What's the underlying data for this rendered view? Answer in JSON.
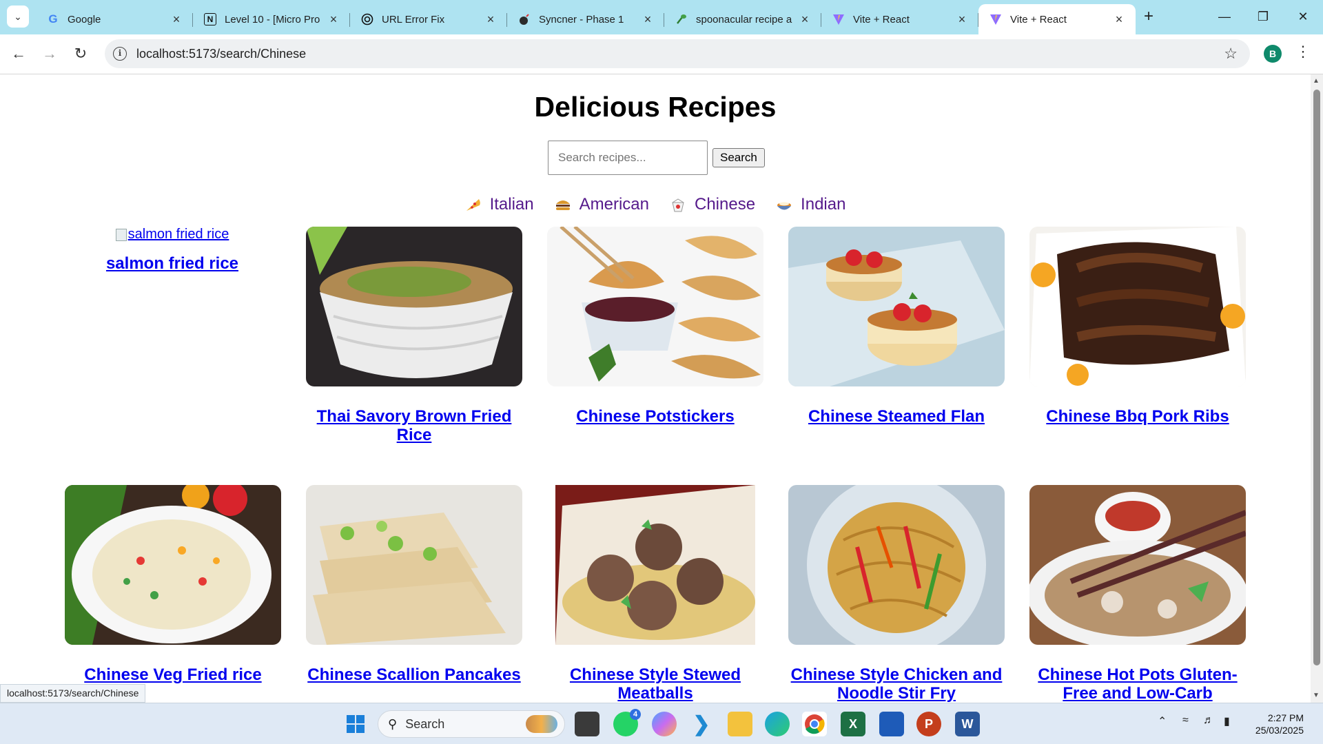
{
  "browser": {
    "tabs": [
      {
        "title": "Google",
        "icon": "google-icon"
      },
      {
        "title": "Level 10 - [Micro Pro",
        "icon": "notion-icon"
      },
      {
        "title": "URL Error Fix",
        "icon": "openai-icon"
      },
      {
        "title": "Syncner - Phase 1",
        "icon": "bomb-icon"
      },
      {
        "title": "spoonacular recipe a",
        "icon": "spoonacular-icon"
      },
      {
        "title": "Vite + React",
        "icon": "vite-icon"
      },
      {
        "title": "Vite + React",
        "icon": "vite-icon",
        "active": true
      }
    ],
    "url": "localhost:5173/search/Chinese",
    "profile_initial": "B",
    "status_url": "localhost:5173/search/Chinese"
  },
  "page": {
    "title": "Delicious Recipes",
    "search_placeholder": "Search recipes...",
    "search_button": "Search",
    "cuisines": [
      {
        "label": "Italian",
        "icon": "pizza-icon"
      },
      {
        "label": "American",
        "icon": "burger-icon"
      },
      {
        "label": "Chinese",
        "icon": "takeout-box-icon"
      },
      {
        "label": "Indian",
        "icon": "curry-icon"
      }
    ],
    "broken_image_alt": "salmon fried rice",
    "recipes": [
      {
        "title": "salmon fried rice"
      },
      {
        "title": "Thai Savory Brown Fried Rice"
      },
      {
        "title": "Chinese Potstickers"
      },
      {
        "title": "Chinese Steamed Flan"
      },
      {
        "title": "Chinese Bbq Pork Ribs"
      },
      {
        "title": "Chinese Veg Fried rice"
      },
      {
        "title": "Chinese Scallion Pancakes"
      },
      {
        "title": "Chinese Style Stewed Meatballs"
      },
      {
        "title": "Chinese Style Chicken and Noodle Stir Fry"
      },
      {
        "title": "Chinese Hot Pots Gluten-Free and Low-Carb"
      }
    ]
  },
  "taskbar": {
    "search_label": "Search",
    "whatsapp_badge": "4",
    "time": "2:27 PM",
    "date": "25/03/2025"
  },
  "colors": {
    "tabbar": "#aee3f1",
    "link": "#0000ee",
    "visited_link": "#551a8b"
  }
}
